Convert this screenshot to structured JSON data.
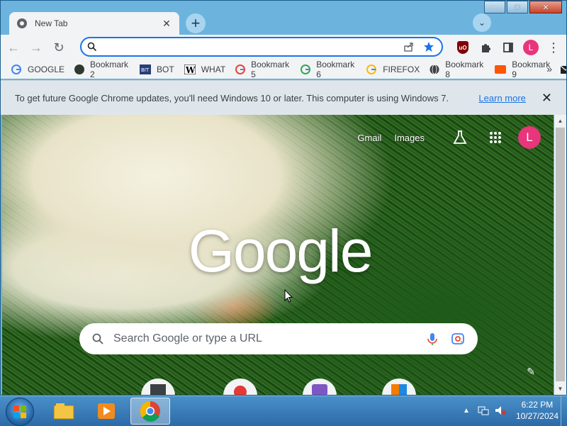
{
  "window": {
    "caption": {
      "minimize": "—",
      "maximize": "□",
      "close": "✕"
    }
  },
  "tabs": [
    {
      "title": "New Tab",
      "close": "✕"
    }
  ],
  "tabstrip": {
    "new_tab": "+",
    "tab_search": "⌄"
  },
  "toolbar": {
    "back": "←",
    "forward": "→",
    "reload": "↻",
    "omnibox": {
      "value": "",
      "placeholder": ""
    },
    "menu": "⋮",
    "avatar_letter": "L"
  },
  "bookmarks": {
    "items": [
      {
        "label": "GOOGLE",
        "icon": "google-g-icon"
      },
      {
        "label": "Bookmark 2",
        "icon": "bot-icon"
      },
      {
        "label": "BOT",
        "icon": "bit-icon"
      },
      {
        "label": "WHAT",
        "icon": "wikipedia-w-icon"
      },
      {
        "label": "Bookmark 5",
        "icon": "google-g-icon"
      },
      {
        "label": "Bookmark 6",
        "icon": "google-g-icon"
      },
      {
        "label": "FIREFOX",
        "icon": "google-g-icon"
      },
      {
        "label": "Bookmark 8",
        "icon": "globe-icon"
      },
      {
        "label": "Bookmark 9",
        "icon": "soundcloud-icon"
      },
      {
        "label": "email",
        "icon": "envelope-icon"
      }
    ],
    "more": "»"
  },
  "infobar": {
    "message": "To get future Google Chrome updates, you'll need Windows 10 or later. This computer is using Windows 7.",
    "link": "Learn more",
    "close": "✕"
  },
  "ntp": {
    "links": [
      "Gmail",
      "Images"
    ],
    "avatar_letter": "L",
    "logo": "Google",
    "search_placeholder": "Search Google or type a URL",
    "edit": "✎"
  },
  "taskbar": {
    "time": "6:22 PM",
    "date": "10/27/2024",
    "tray_expand": "▲"
  },
  "colors": {
    "accent": "#1a73e8",
    "avatar": "#e8357b",
    "titlebar": "#6cb4dd"
  }
}
